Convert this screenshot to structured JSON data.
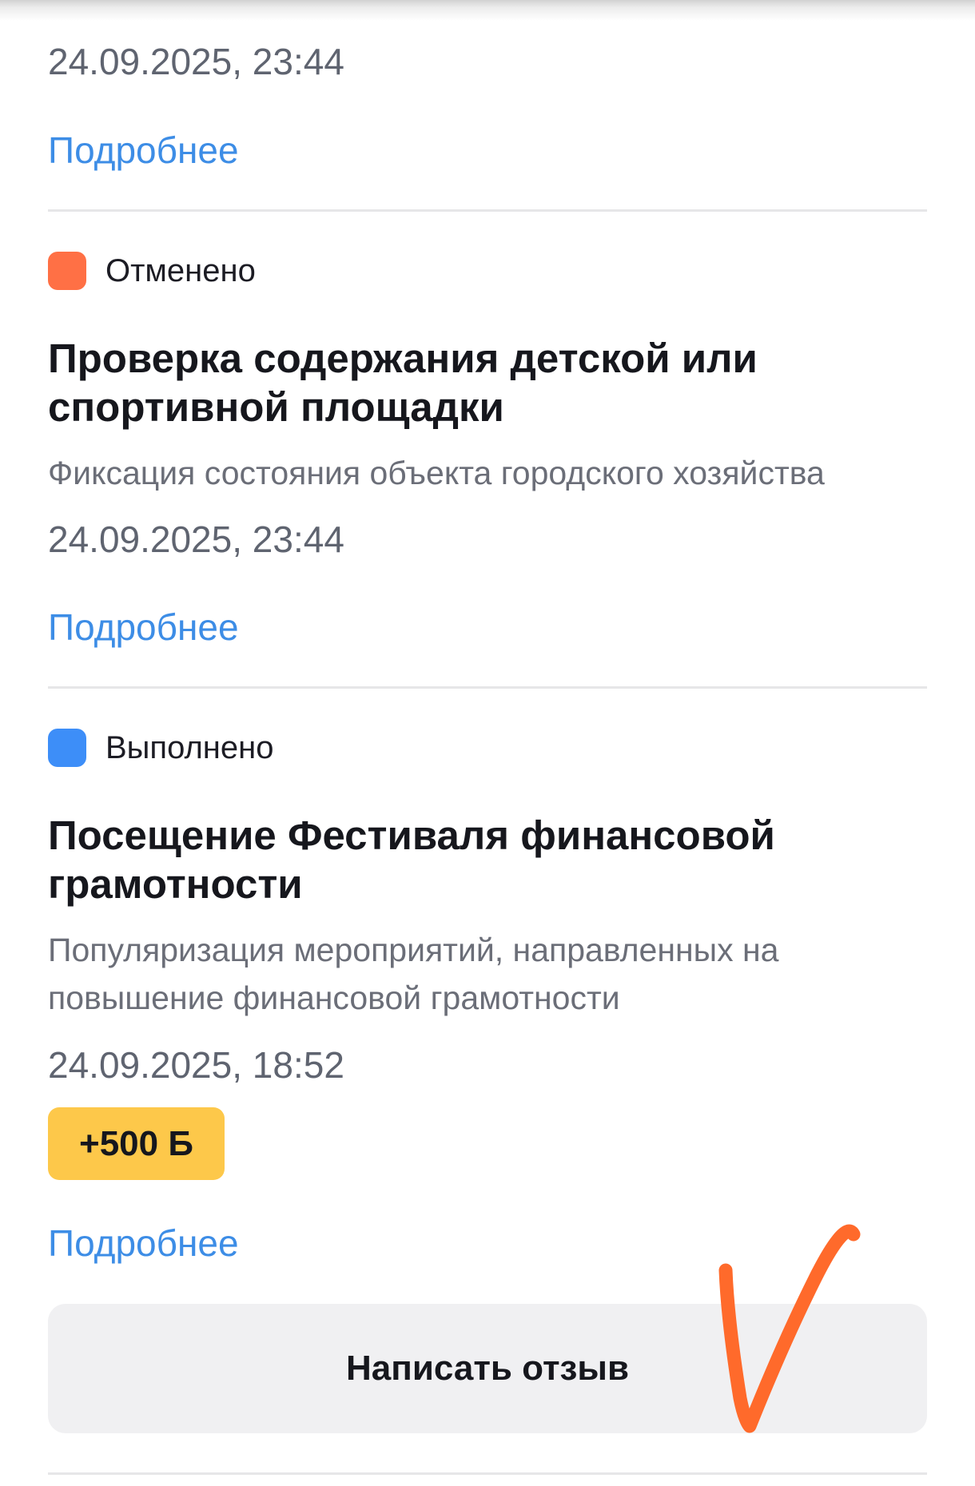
{
  "items": [
    {
      "date": "24.09.2025, 23:44",
      "more_label": "Подробнее"
    },
    {
      "status": {
        "label": "Отменено",
        "color": "#ff7045"
      },
      "title": "Проверка содержания детской или спортивной площадки",
      "subtitle": "Фиксация состояния объекта городского хозяйства",
      "date": "24.09.2025, 23:44",
      "more_label": "Подробнее"
    },
    {
      "status": {
        "label": "Выполнено",
        "color": "#3d8ef8"
      },
      "title": "Посещение Фестиваля финансовой грамотности",
      "subtitle": "Популяризация мероприятий, направленных на повышение финансовой грамотности",
      "date": "24.09.2025, 18:52",
      "points": "+500 Б",
      "more_label": "Подробнее",
      "review_label": "Написать отзыв"
    }
  ],
  "colors": {
    "link": "#3d8de6",
    "badge": "#fdc84a",
    "annotation": "#ff6a2b"
  },
  "annotation": {
    "icon": "handwritten-check-mark"
  }
}
